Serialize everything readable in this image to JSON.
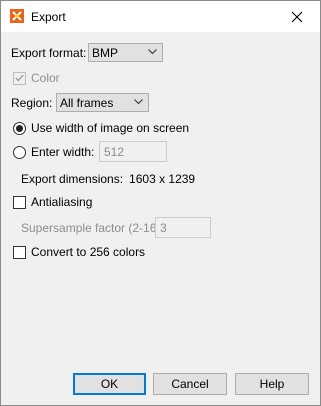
{
  "window": {
    "title": "Export"
  },
  "format": {
    "label": "Export format:",
    "value": "BMP"
  },
  "color": {
    "label": "Color",
    "checked": true
  },
  "region": {
    "label": "Region:",
    "value": "All frames"
  },
  "width_mode": {
    "use_screen_label": "Use width of image on screen",
    "enter_width_label": "Enter width:",
    "enter_width_value": "512",
    "selected": "use_screen"
  },
  "dimensions": {
    "label": "Export dimensions:",
    "value": "1603 x 1239"
  },
  "antialiasing": {
    "label": "Antialiasing",
    "checked": false
  },
  "supersample": {
    "label": "Supersample factor (2-16):",
    "value": "3"
  },
  "convert256": {
    "label": "Convert to 256 colors",
    "checked": false
  },
  "buttons": {
    "ok": "OK",
    "cancel": "Cancel",
    "help": "Help"
  }
}
